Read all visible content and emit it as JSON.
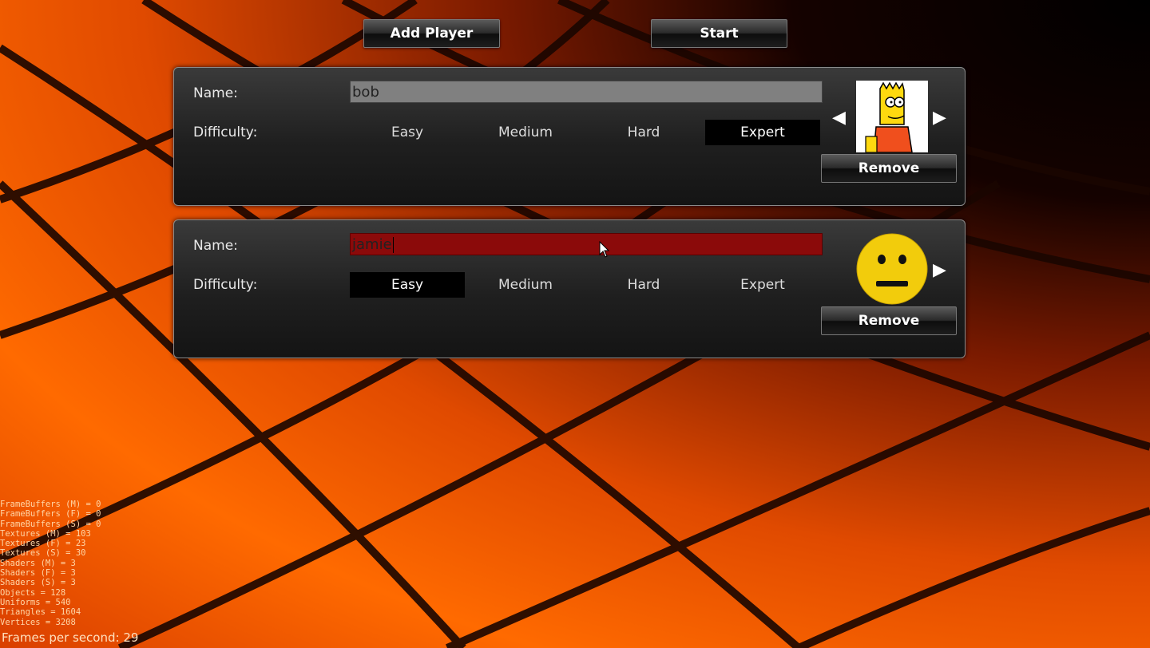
{
  "colors": {
    "name_field_inactive": "#808080",
    "name_field_active": "#8b0a0a",
    "selected_option_bg": "#000000",
    "background_orange": "#ff6a00"
  },
  "toolbar": {
    "add_player_label": "Add Player",
    "start_label": "Start"
  },
  "players": [
    {
      "name_label": "Name:",
      "name_value": "bob",
      "difficulty_label": "Difficulty:",
      "difficulty_options": [
        "Easy",
        "Medium",
        "Hard",
        "Expert"
      ],
      "selected_difficulty": "Expert",
      "avatar_icon": "cartoon-boy-avatar",
      "remove_label": "Remove",
      "field_active": false
    },
    {
      "name_label": "Name:",
      "name_value": "jamie",
      "difficulty_label": "Difficulty:",
      "difficulty_options": [
        "Easy",
        "Medium",
        "Hard",
        "Expert"
      ],
      "selected_difficulty": "Easy",
      "avatar_icon": "neutral-face-avatar",
      "remove_label": "Remove",
      "field_active": true
    }
  ],
  "stats": [
    "FrameBuffers (M) = 0",
    "FrameBuffers (F) = 0",
    "FrameBuffers (S) = 0",
    "Textures (M) = 103",
    "Textures (F) = 23",
    "Textures (S) = 30",
    "Shaders (M) = 3",
    "Shaders (F) = 3",
    "Shaders (S) = 3",
    "Objects = 128",
    "Uniforms = 540",
    "Triangles = 1604",
    "Vertices = 3208"
  ],
  "fps_text": "Frames per second: 29"
}
